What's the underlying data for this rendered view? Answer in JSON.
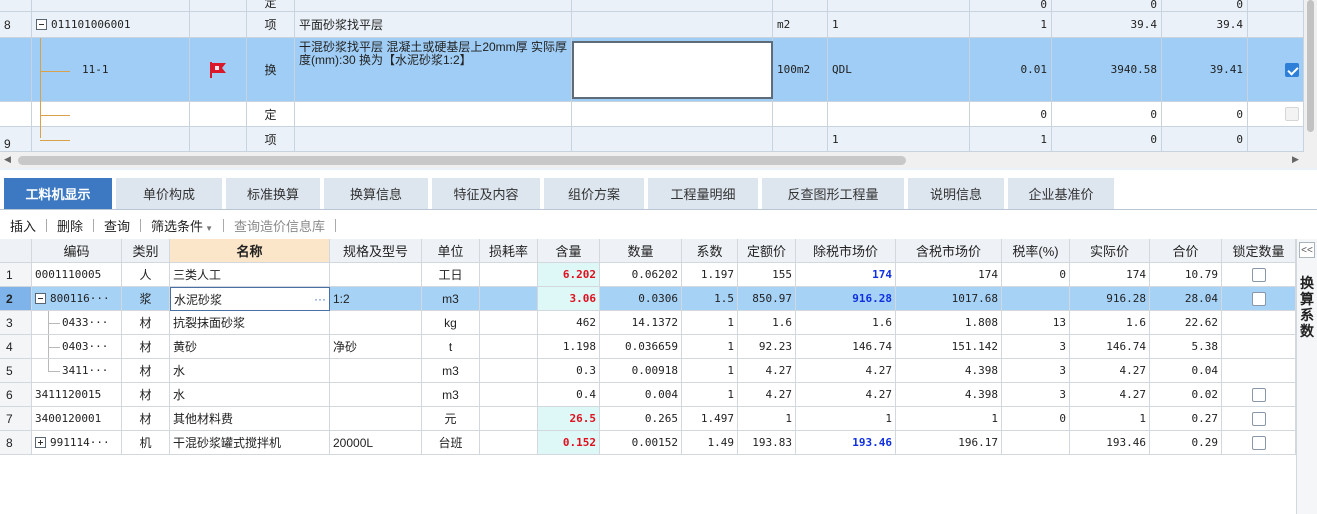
{
  "top_grid": {
    "rows": [
      {
        "num": "",
        "code": "",
        "type": "定",
        "desc": "",
        "unit": "",
        "qty_expr": "",
        "qty": "0",
        "price": "0",
        "total": "0",
        "checked": false
      },
      {
        "num": "8",
        "code": "011101006001",
        "type": "项",
        "desc": "平面砂浆找平层",
        "unit": "m2",
        "qty_expr": "1",
        "qty": "1",
        "price": "39.4",
        "total": "39.4",
        "checked": false
      },
      {
        "num": "",
        "code": "11-1",
        "type": "换",
        "desc": "干混砂浆找平层 混凝土或硬基层上20mm厚 实际厚度(mm):30 换为【水泥砂浆1:2】",
        "unit": "100m2",
        "qty_expr": "QDL",
        "qty": "0.01",
        "price": "3940.58",
        "total": "39.41",
        "checked": true
      },
      {
        "num": "",
        "code": "",
        "type": "定",
        "desc": "",
        "unit": "",
        "qty_expr": "",
        "qty": "0",
        "price": "0",
        "total": "0",
        "checked": false
      },
      {
        "num": "9",
        "code": "",
        "type": "项",
        "desc": "",
        "unit": "",
        "qty_expr": "1",
        "qty": "1",
        "price": "0",
        "total": "0",
        "checked": false
      }
    ]
  },
  "tabs": [
    {
      "label": "工料机显示",
      "active": true
    },
    {
      "label": "单价构成"
    },
    {
      "label": "标准换算"
    },
    {
      "label": "换算信息"
    },
    {
      "label": "特征及内容"
    },
    {
      "label": "组价方案"
    },
    {
      "label": "工程量明细"
    },
    {
      "label": "反查图形工程量"
    },
    {
      "label": "说明信息"
    },
    {
      "label": "企业基准价"
    }
  ],
  "toolbar": {
    "insert": "插入",
    "delete": "删除",
    "query": "查询",
    "filter": "筛选条件",
    "price_db": "查询造价信息库"
  },
  "bottom_grid": {
    "headers": [
      "",
      "编码",
      "类别",
      "名称",
      "规格及型号",
      "单位",
      "损耗率",
      "含量",
      "数量",
      "系数",
      "定额价",
      "除税市场价",
      "含税市场价",
      "税率(%)",
      "实际价",
      "合价",
      "锁定数量"
    ],
    "rows": [
      {
        "n": "1",
        "code": "0001110005",
        "cat": "人",
        "name": "三类人工",
        "spec": "",
        "unit": "工日",
        "loss": "",
        "content": "6.202",
        "qty": "0.06202",
        "coef": "1.197",
        "quota": "155",
        "ex_tax": "174",
        "inc_tax": "174",
        "rate": "0",
        "actual": "174",
        "sum": "10.79",
        "lock": true
      },
      {
        "n": "2",
        "code": "800116···",
        "cat": "浆",
        "name": "水泥砂浆",
        "spec": "1:2",
        "unit": "m3",
        "loss": "",
        "content": "3.06",
        "qty": "0.0306",
        "coef": "1.5",
        "quota": "850.97",
        "ex_tax": "916.28",
        "inc_tax": "1017.68",
        "rate": "",
        "actual": "916.28",
        "sum": "28.04",
        "lock": true
      },
      {
        "n": "3",
        "code": "0433···",
        "cat": "材",
        "name": "抗裂抹面砂浆",
        "spec": "",
        "unit": "kg",
        "loss": "",
        "content": "462",
        "qty": "14.1372",
        "coef": "1",
        "quota": "1.6",
        "ex_tax": "1.6",
        "inc_tax": "1.808",
        "rate": "13",
        "actual": "1.6",
        "sum": "22.62",
        "lock": false
      },
      {
        "n": "4",
        "code": "0403···",
        "cat": "材",
        "name": "黄砂",
        "spec": "净砂",
        "unit": "t",
        "loss": "",
        "content": "1.198",
        "qty": "0.036659",
        "coef": "1",
        "quota": "92.23",
        "ex_tax": "146.74",
        "inc_tax": "151.142",
        "rate": "3",
        "actual": "146.74",
        "sum": "5.38",
        "lock": false
      },
      {
        "n": "5",
        "code": "3411···",
        "cat": "材",
        "name": "水",
        "spec": "",
        "unit": "m3",
        "loss": "",
        "content": "0.3",
        "qty": "0.00918",
        "coef": "1",
        "quota": "4.27",
        "ex_tax": "4.27",
        "inc_tax": "4.398",
        "rate": "3",
        "actual": "4.27",
        "sum": "0.04",
        "lock": false
      },
      {
        "n": "6",
        "code": "3411120015",
        "cat": "材",
        "name": "水",
        "spec": "",
        "unit": "m3",
        "loss": "",
        "content": "0.4",
        "qty": "0.004",
        "coef": "1",
        "quota": "4.27",
        "ex_tax": "4.27",
        "inc_tax": "4.398",
        "rate": "3",
        "actual": "4.27",
        "sum": "0.02",
        "lock": true
      },
      {
        "n": "7",
        "code": "3400120001",
        "cat": "材",
        "name": "其他材料费",
        "spec": "",
        "unit": "元",
        "loss": "",
        "content": "26.5",
        "qty": "0.265",
        "coef": "1.497",
        "quota": "1",
        "ex_tax": "1",
        "inc_tax": "1",
        "rate": "0",
        "actual": "1",
        "sum": "0.27",
        "lock": true
      },
      {
        "n": "8",
        "code": "991114···",
        "cat": "机",
        "name": "干混砂浆罐式搅拌机",
        "spec": "20000L",
        "unit": "台班",
        "loss": "",
        "content": "0.152",
        "qty": "0.00152",
        "coef": "1.49",
        "quota": "193.83",
        "ex_tax": "193.46",
        "inc_tax": "196.17",
        "rate": "",
        "actual": "193.46",
        "sum": "0.29",
        "lock": true
      }
    ]
  },
  "side_panel": {
    "label": "换算系数",
    "collapse_glyph": "<<"
  },
  "colors": {
    "selected_row": "#9fcdf5",
    "active_tab": "#3c79c2",
    "highlight_text": "#e0101e",
    "blue_text": "#1030e0",
    "flag": "#d9182b"
  }
}
